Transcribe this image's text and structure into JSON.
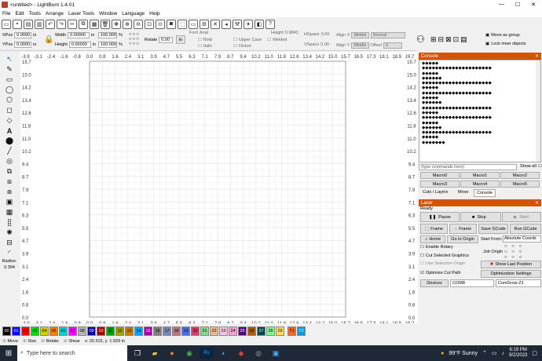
{
  "window": {
    "title": "<untitled> - LightBurn 1.4.01"
  },
  "menu": [
    "File",
    "Edit",
    "Tools",
    "Arrange",
    "Laser Tools",
    "Window",
    "Language",
    "Help"
  ],
  "toolbar2": {
    "xpos_label": "XPos",
    "xpos": "0.0000",
    "ypos_label": "YPos",
    "ypos": "0.0000",
    "unit": "in",
    "width_label": "Width",
    "width": "0.00000",
    "height_label": "Height",
    "height": "0.00000",
    "scale_w": "100.000",
    "scale_h": "100.000",
    "pct": "%",
    "rotate_label": "Rotate",
    "rotate": "0.00",
    "in_button": "in",
    "font_label": "Font",
    "font": "Arial",
    "bold": "Bold",
    "italic": "Italic",
    "upper_case": "Upper Case",
    "welded": "Welded",
    "distort": "Distort",
    "text_height_label": "Height",
    "text_height": "0.9843",
    "hspace_label": "HSpace",
    "hspace": "0.00",
    "vspace_label": "VSpace",
    "vspace": "0.00",
    "align_x_label": "Align X",
    "align_x": "Middle",
    "align_y_label": "Align Y",
    "align_y": "Middle",
    "normal": "Normal",
    "offset_label": "Offset",
    "offset": "0"
  },
  "move_opts": {
    "move_as_group": "Move as group",
    "lock_inner": "Lock inner objects"
  },
  "ruler": {
    "x_ticks": [
      "-3.9",
      "-3.1",
      "-2.4",
      "-1.6",
      "-0.8",
      "0.0",
      "0.8",
      "1.6",
      "2.4",
      "3.1",
      "3.9",
      "4.7",
      "5.5",
      "6.3",
      "7.1",
      "7.9",
      "8.7",
      "9.4",
      "10.2",
      "11.0",
      "11.8",
      "12.6",
      "13.4",
      "14.2",
      "15.0",
      "15.7",
      "16.5",
      "17.3",
      "18.1",
      "18.9",
      "19.7"
    ],
    "y_ticks": [
      "15.7",
      "15.0",
      "14.2",
      "13.4",
      "12.6",
      "11.8",
      "11.0",
      "10.2",
      "9.4",
      "8.7",
      "7.9",
      "7.1",
      "6.3",
      "5.5",
      "4.7",
      "3.9",
      "3.1",
      "2.4",
      "1.6",
      "0.8",
      "0.0"
    ]
  },
  "radius": {
    "label": "Radius:",
    "value": "0.394"
  },
  "console": {
    "title": "Console",
    "lines": [
      "◆◆◆◆◆",
      "◆◆◆◆◆◆◆◆◆◆◆◆◆◆◆◆◆◆◆◆◆",
      "◆◆◆◆◆",
      "◆◆◆◆◆◆",
      "◆◆◆◆◆◆◆◆◆◆◆◆◆◆◆◆◆◆◆◆◆",
      "◆◆◆◆◆",
      "◆◆◆◆◆◆◆◆◆◆◆◆◆◆◆◆◆◆◆◆◆",
      "◆◆◆◆◆",
      "◆◆◆◆◆◆",
      "◆◆◆◆◆◆◆◆◆◆◆◆◆◆◆◆◆◆◆◆◆",
      "◆◆◆◆◆",
      "◆◆◆◆◆◆◆◆◆◆◆◆◆◆◆◆◆◆◆◆◆",
      "◆◆◆◆◆",
      "◆◆◆◆◆◆",
      "◆◆◆◆◆◆◆◆◆◆◆◆◆◆◆◆◆◆◆◆◆",
      "◆◆◆◆◆",
      "◆◆◆◆◆◆◆"
    ],
    "placeholder": "(type commands here)",
    "show_all": "Show all",
    "macros": [
      "Macro0",
      "Macro1",
      "Macro2",
      "Macro3",
      "Macro4",
      "Macro5"
    ],
    "tabs": [
      "Cuts / Layers",
      "Move",
      "Console"
    ]
  },
  "laser": {
    "title": "Laser",
    "status": "Ready",
    "pause": "Pause",
    "stop": "Stop",
    "start": "Start",
    "frame1": "Frame",
    "frame2": "Frame",
    "save_gcode": "Save GCode",
    "run_gcode": "Run GCode",
    "home": "Home",
    "go_to_origin": "Go to Origin",
    "start_from_label": "Start From:",
    "start_from": "Absolute Coords",
    "enable_rotary": "Enable Rotary",
    "job_origin": "Job Origin",
    "cut_selected": "Cut Selected Graphics",
    "use_selection_origin": "Use Selection Origin",
    "show_last_position": "Show Last Position",
    "optimize_cut_path": "Optimize Cut Path",
    "optimization_settings": "Optimization Settings",
    "devices": "Devices",
    "port": "COM8",
    "device": "ComGrow Z1"
  },
  "palette": [
    {
      "label": "00",
      "color": "#000000",
      "fg": "#ffffff"
    },
    {
      "label": "01",
      "color": "#0000ff",
      "fg": "#ffffff"
    },
    {
      "label": "02",
      "color": "#ff0000",
      "fg": "#000000"
    },
    {
      "label": "03",
      "color": "#00e000",
      "fg": "#000000"
    },
    {
      "label": "04",
      "color": "#d0d000",
      "fg": "#000000"
    },
    {
      "label": "05",
      "color": "#ff8000",
      "fg": "#000000"
    },
    {
      "label": "06",
      "color": "#00d0d0",
      "fg": "#000000"
    },
    {
      "label": "07",
      "color": "#ff00ff",
      "fg": "#000000"
    },
    {
      "label": "08",
      "color": "#b4b4b4",
      "fg": "#000000"
    },
    {
      "label": "09",
      "color": "#0000a0",
      "fg": "#ffffff"
    },
    {
      "label": "10",
      "color": "#a00000",
      "fg": "#ffffff"
    },
    {
      "label": "11",
      "color": "#00a000",
      "fg": "#000000"
    },
    {
      "label": "12",
      "color": "#a0a000",
      "fg": "#000000"
    },
    {
      "label": "13",
      "color": "#c08000",
      "fg": "#000000"
    },
    {
      "label": "14",
      "color": "#00a0ff",
      "fg": "#000000"
    },
    {
      "label": "15",
      "color": "#a000a0",
      "fg": "#ffffff"
    },
    {
      "label": "16",
      "color": "#808080",
      "fg": "#000000"
    },
    {
      "label": "17",
      "color": "#7d87b9",
      "fg": "#000000"
    },
    {
      "label": "18",
      "color": "#bb7784",
      "fg": "#000000"
    },
    {
      "label": "19",
      "color": "#4a6fe3",
      "fg": "#000000"
    },
    {
      "label": "20",
      "color": "#d33f6a",
      "fg": "#000000"
    },
    {
      "label": "21",
      "color": "#8cd78c",
      "fg": "#000000"
    },
    {
      "label": "22",
      "color": "#f0b98d",
      "fg": "#000000"
    },
    {
      "label": "23",
      "color": "#f6c4e1",
      "fg": "#000000"
    },
    {
      "label": "24",
      "color": "#fa9ed4",
      "fg": "#000000"
    },
    {
      "label": "25",
      "color": "#500a78",
      "fg": "#ffffff"
    },
    {
      "label": "26",
      "color": "#b45a00",
      "fg": "#000000"
    },
    {
      "label": "27",
      "color": "#004754",
      "fg": "#ffffff"
    },
    {
      "label": "28",
      "color": "#86fa88",
      "fg": "#000000"
    },
    {
      "label": "29",
      "color": "#ffdb66",
      "fg": "#000000"
    },
    {
      "label": "T1",
      "color": "#f36926",
      "fg": "#000000"
    },
    {
      "label": "T2",
      "color": "#0c96d9",
      "fg": "#ffffff"
    }
  ],
  "status": {
    "move": "Move",
    "size": "Size",
    "rotate": "Rotate",
    "shear": "Shear",
    "coords": "x: 20.315, y: 1.929 in"
  },
  "taskbar": {
    "search": "Type here to search",
    "weather": "99°F  Sunny",
    "time": "6:19 PM",
    "date": "9/2/2023"
  },
  "colors": {
    "accent": "#d35400",
    "taskbar": "#1f2836"
  }
}
